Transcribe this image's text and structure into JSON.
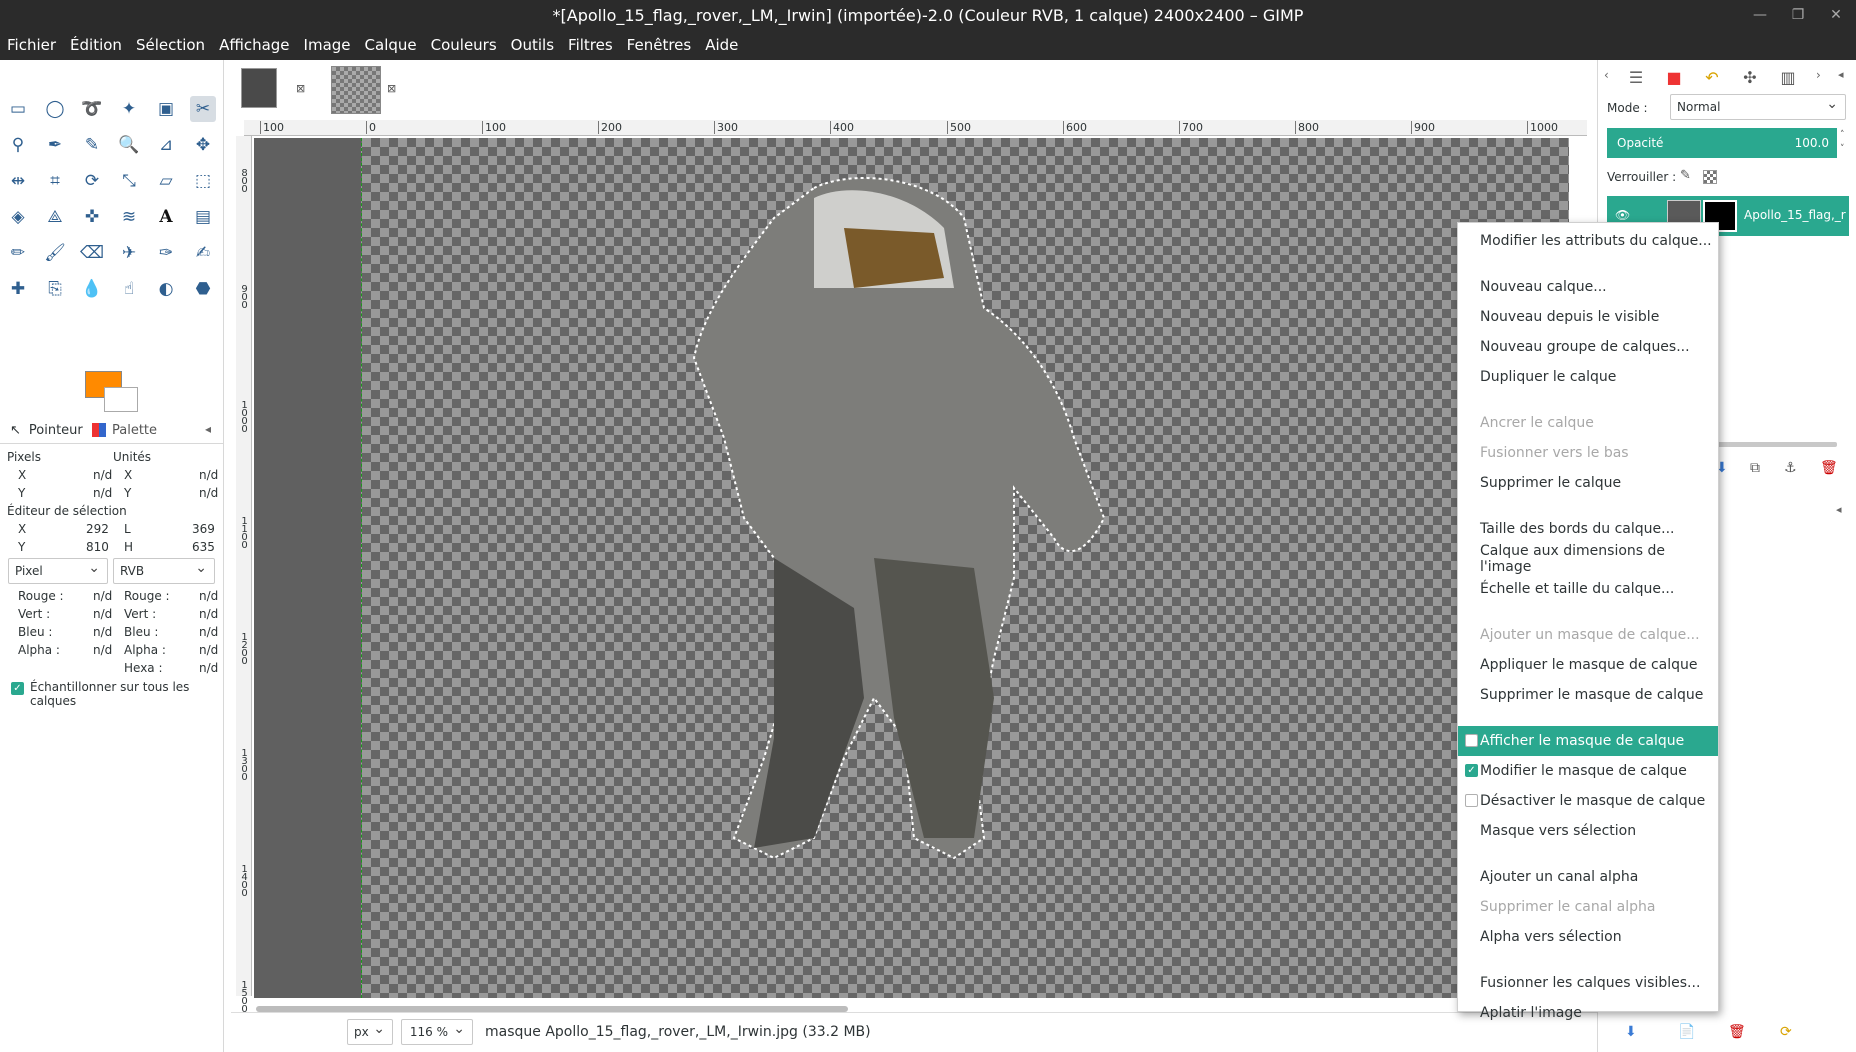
{
  "window": {
    "title": "*[Apollo_15_flag,_rover,_LM,_Irwin] (importée)-2.0 (Couleur RVB, 1 calque) 2400x2400 – GIMP"
  },
  "menubar": [
    "Fichier",
    "Édition",
    "Sélection",
    "Affichage",
    "Image",
    "Calque",
    "Couleurs",
    "Outils",
    "Filtres",
    "Fenêtres",
    "Aide"
  ],
  "pointer_panel": {
    "tab_pointer": "Pointeur",
    "tab_palette": "Palette",
    "pixels_label": "Pixels",
    "units_label": "Unités",
    "x": "X",
    "y": "Y",
    "nd": "n/d",
    "sel_editor": "Éditeur de sélection",
    "sel_x": "292",
    "sel_y": "810",
    "sel_l_label": "L",
    "sel_l": "369",
    "sel_h_label": "H",
    "sel_h": "635",
    "unit_combo": "Pixel",
    "color_combo": "RVB",
    "rouge": "Rouge :",
    "vert": "Vert :",
    "bleu": "Bleu :",
    "alpha": "Alpha :",
    "hexa": "Hexa :",
    "sample_all": "Échantillonner sur tous les calques"
  },
  "ruler_h": [
    "100",
    "0",
    "100",
    "200",
    "300",
    "400",
    "500",
    "600",
    "700",
    "800",
    "900",
    "1000"
  ],
  "ruler_v": [
    "800",
    "900",
    "1000",
    "1100",
    "1200",
    "1300",
    "1400",
    "1500"
  ],
  "status": {
    "unit": "px",
    "zoom": "116 %",
    "message": "masque Apollo_15_flag,_rover,_LM,_Irwin.jpg (33.2 MB)"
  },
  "layers": {
    "mode_label": "Mode :",
    "mode": "Normal",
    "opacity_label": "Opacité",
    "opacity": "100.0",
    "lock_label": "Verrouiller :",
    "layer_name": "Apollo_15_flag,_r"
  },
  "context_menu": [
    {
      "label": "Modifier les attributs du calque...",
      "state": "normal"
    },
    {
      "label": "Nouveau calque...",
      "state": "normal"
    },
    {
      "label": "Nouveau depuis le visible",
      "state": "normal"
    },
    {
      "label": "Nouveau groupe de calques...",
      "state": "normal"
    },
    {
      "label": "Dupliquer le calque",
      "state": "normal"
    },
    {
      "label": "Ancrer le calque",
      "state": "disabled"
    },
    {
      "label": "Fusionner vers le bas",
      "state": "disabled"
    },
    {
      "label": "Supprimer le calque",
      "state": "normal"
    },
    {
      "label": "Taille des bords du calque...",
      "state": "normal"
    },
    {
      "label": "Calque aux dimensions de l'image",
      "state": "normal"
    },
    {
      "label": "Échelle et taille du calque...",
      "state": "normal"
    },
    {
      "label": "Ajouter un masque de calque...",
      "state": "disabled"
    },
    {
      "label": "Appliquer le masque de calque",
      "state": "normal"
    },
    {
      "label": "Supprimer le masque de calque",
      "state": "normal"
    },
    {
      "label": "Afficher le masque de calque",
      "state": "highlighted",
      "checkbox": false
    },
    {
      "label": "Modifier le masque de calque",
      "state": "normal",
      "checkbox": true
    },
    {
      "label": "Désactiver le masque de calque",
      "state": "normal",
      "checkbox": false
    },
    {
      "label": "Masque vers sélection",
      "state": "normal"
    },
    {
      "label": "Ajouter un canal alpha",
      "state": "normal"
    },
    {
      "label": "Supprimer le canal alpha",
      "state": "disabled"
    },
    {
      "label": "Alpha vers sélection",
      "state": "normal"
    },
    {
      "label": "Fusionner les calques visibles...",
      "state": "normal"
    },
    {
      "label": "Aplatir l'image",
      "state": "normal"
    }
  ],
  "colors": {
    "accent": "#2aa88f",
    "foreground": "#ff8a00",
    "background": "#ffffff",
    "titlebar": "#2b2b2b"
  },
  "icons": [
    "rect-select-icon",
    "ellipse-select-icon",
    "lasso-icon",
    "fuzzy-select-icon",
    "color-select-icon",
    "scissors-icon",
    "foreground-select-icon",
    "paths-icon",
    "color-picker-icon",
    "zoom-icon",
    "measure-icon",
    "move-icon",
    "align-icon",
    "crop-icon",
    "rotate-icon",
    "scale-icon",
    "shear-icon",
    "perspective-icon",
    "3d-transform-icon",
    "unified-transform-icon",
    "handle-transform-icon",
    "warp-icon",
    "text-icon",
    "gradient-icon",
    "pencil-icon",
    "paintbrush-icon",
    "eraser-icon",
    "airbrush-icon",
    "ink-icon",
    "mypaint-icon",
    "heal-icon",
    "clone-icon",
    "blur-icon",
    "smudge-icon",
    "dodge-icon",
    "bucket-fill-icon"
  ]
}
